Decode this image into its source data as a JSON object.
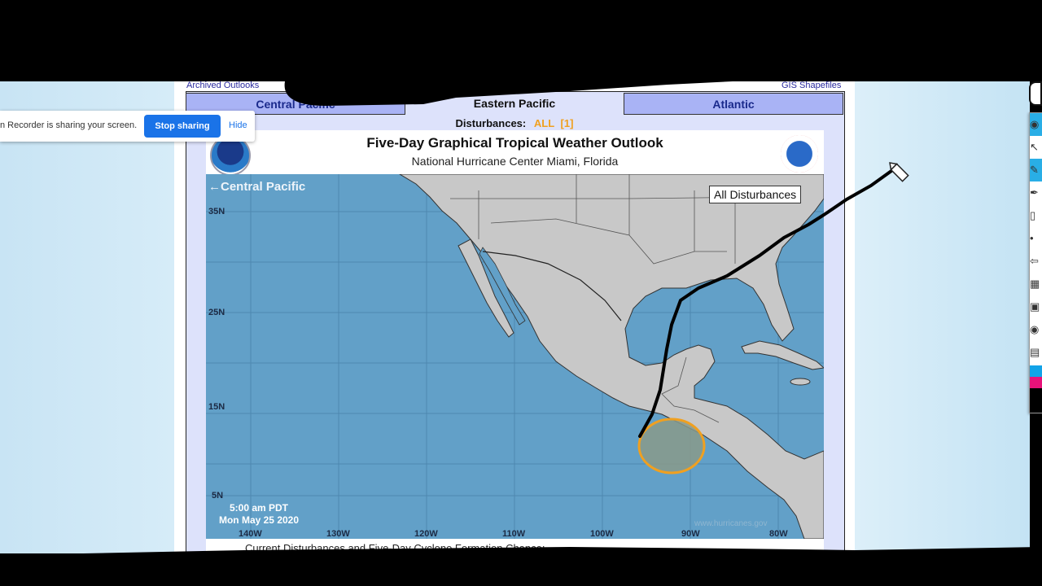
{
  "page": {
    "top_links": {
      "left": "Archived Outlooks",
      "right": "GIS Shapefiles"
    },
    "tabs": [
      {
        "label": "Central Pacific",
        "active": false
      },
      {
        "label": "Eastern Pacific",
        "active": true
      },
      {
        "label": "Atlantic",
        "active": false
      }
    ],
    "disturbances": {
      "label": "Disturbances:",
      "all": "ALL",
      "count": "[1]"
    },
    "header": {
      "title": "Five-Day Graphical Tropical Weather Outlook",
      "subtitle": "National Hurricane Center  Miami, Florida",
      "left_logo": "noaa-logo",
      "right_logo": "national-weather-service-logo"
    },
    "map": {
      "central_pacific_link": "←Central Pacific",
      "all_disturbances_label": "All Disturbances",
      "lat_labels": [
        "35N",
        "25N",
        "15N",
        "5N"
      ],
      "lon_labels": [
        "140W",
        "130W",
        "120W",
        "110W",
        "100W",
        "90W",
        "80W"
      ],
      "timestamp": [
        "5:00 am PDT",
        "Mon May 25 2020"
      ],
      "watermark": "www.hurricanes.gov",
      "disturbance_area": {
        "color": "#f0a020",
        "fill": "#8a9a8a"
      }
    },
    "footer": {
      "text": "Current Disturbances and Five-Day Cyclone Formation Chance:"
    }
  },
  "screen_share": {
    "message": "n Recorder is sharing your screen.",
    "stop_label": "Stop sharing",
    "hide_label": "Hide"
  },
  "annotation_toolbar": {
    "tools": [
      "eye-icon",
      "cursor-icon",
      "highlighter-icon",
      "pen-icon",
      "eraser-icon",
      "dot-icon",
      "undo-icon",
      "trash-icon",
      "whiteboard-icon",
      "camera-icon",
      "clipboard-icon"
    ],
    "colors": [
      "#12a3e8",
      "#e8127a",
      "#000000"
    ]
  },
  "colors": {
    "ocean": "#62a0c8",
    "land": "#c8c8c8",
    "tab_inactive": "#a9b3f5",
    "frame": "#dde2fb",
    "accent_blue": "#1a73e8"
  }
}
